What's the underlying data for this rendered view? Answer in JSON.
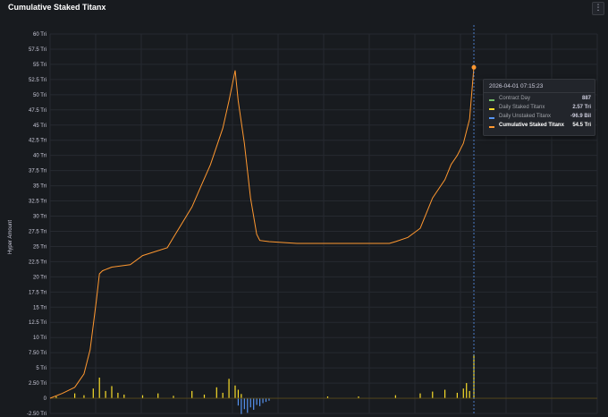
{
  "panel": {
    "title": "Cumulative Staked Titanx",
    "menu_icon": "kebab-menu-icon",
    "y_axis_label": "Hyper Amount"
  },
  "tooltip": {
    "time": "2026-04-01 07:15:23",
    "rows": [
      {
        "name": "Contract Day",
        "value": "887",
        "color": "#73bf69"
      },
      {
        "name": "Daily Staked Titanx",
        "value": "2.57 Tri",
        "color": "#fade2a"
      },
      {
        "name": "Daily Unstaked Titanx",
        "value": "-96.9 Bil",
        "color": "#5794f2"
      },
      {
        "name": "Cumulative Staked Titanx",
        "value": "54.5 Tri",
        "color": "#ff9830"
      }
    ]
  },
  "chart_data": {
    "type": "line",
    "ylabel": "Hyper Amount",
    "ylim": [
      -2.5,
      60
    ],
    "xlim": [
      0,
      887
    ],
    "y_tick_labels": [
      "-2.50 Tri",
      "0",
      "2.50 Tri",
      "5 Tri",
      "7.50 Tri",
      "10 Tri",
      "12.5 Tri",
      "15 Tri",
      "17.5 Tri",
      "20 Tri",
      "22.5 Tri",
      "25 Tri",
      "27.5 Tri",
      "30 Tri",
      "32.5 Tri",
      "35 Tri",
      "37.5 Tri",
      "40 Tri",
      "42.5 Tri",
      "45 Tri",
      "47.5 Tri",
      "50 Tri",
      "52.5 Tri",
      "55 Tri",
      "57.5 Tri",
      "60 Tri"
    ],
    "y_tick_values": [
      -2.5,
      0,
      2.5,
      5,
      7.5,
      10,
      12.5,
      15,
      17.5,
      20,
      22.5,
      25,
      27.5,
      30,
      32.5,
      35,
      37.5,
      40,
      42.5,
      45,
      47.5,
      50,
      52.5,
      55,
      57.5,
      60
    ],
    "grid": true,
    "series": [
      {
        "name": "Cumulative Staked Titanx",
        "color": "#ff9830",
        "x": [
          0,
          20,
          40,
          55,
          65,
          75,
          80,
          85,
          90,
          95,
          100,
          130,
          150,
          190,
          200,
          230,
          245,
          260,
          280,
          290,
          300,
          305,
          315,
          325,
          335,
          340,
          355,
          400,
          500,
          550,
          560,
          580,
          600,
          620,
          630,
          640,
          650,
          660,
          670,
          680,
          687
        ],
        "y": [
          0,
          0.8,
          1.8,
          4,
          8,
          16,
          20.5,
          21,
          21.2,
          21.4,
          21.6,
          22,
          23.5,
          24.8,
          26.5,
          31.5,
          35,
          38.5,
          44.5,
          49,
          54,
          49,
          42,
          33,
          27,
          26,
          25.8,
          25.5,
          25.5,
          25.5,
          25.8,
          26.5,
          28,
          33,
          34.5,
          36,
          38.5,
          40,
          42,
          46,
          54.5
        ]
      },
      {
        "name": "Daily Staked Titanx",
        "color": "#fade2a",
        "x": [
          10,
          40,
          55,
          70,
          80,
          90,
          100,
          110,
          120,
          150,
          175,
          200,
          230,
          250,
          270,
          280,
          290,
          300,
          305,
          310,
          450,
          500,
          560,
          600,
          620,
          640,
          660,
          670,
          675,
          680,
          687
        ],
        "y": [
          0.3,
          0.8,
          0.5,
          1.6,
          3.4,
          1.2,
          2,
          0.9,
          0.6,
          0.5,
          0.8,
          0.4,
          1.2,
          0.6,
          1.8,
          0.9,
          3.2,
          2.1,
          1.4,
          0.7,
          0.3,
          0.3,
          0.5,
          0.8,
          1.1,
          1.4,
          0.9,
          1.6,
          2.5,
          1.2,
          7.2
        ]
      },
      {
        "name": "Daily Unstaked Titanx",
        "color": "#5794f2",
        "x": [
          305,
          310,
          315,
          320,
          325,
          330,
          335,
          340,
          345,
          350,
          355
        ],
        "y": [
          -1.2,
          -2.6,
          -1.8,
          -2.4,
          -1.5,
          -1.9,
          -1.1,
          -1.3,
          -0.8,
          -0.6,
          -0.4
        ]
      }
    ],
    "crosshair_x": 687
  }
}
